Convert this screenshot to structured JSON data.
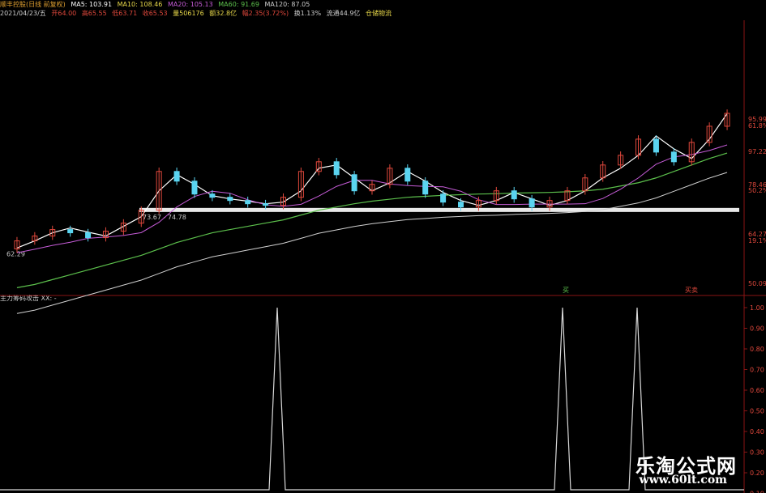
{
  "header": {
    "stock_title": "顺丰控股(日线 前复权)",
    "ma5": "MA5: 103.91",
    "ma10": "MA10: 108.46",
    "ma20": "MA20: 105.13",
    "ma60": "MA60: 91.69",
    "ma120": "MA120: 87.05",
    "date": "2021/04/23/五",
    "open": "开64.00",
    "high": "高65.55",
    "low": "低63.71",
    "close": "收65.53",
    "volume": "量506176",
    "amount": "额32.8亿",
    "change": "幅2.35(3.72%)",
    "turnover": "换1.13%",
    "float_cap": "流通44.9亿",
    "sector": "仓储物流"
  },
  "colors": {
    "bg": "#000000",
    "up": "#e0483c",
    "down": "#5ad4f0",
    "ma5": "#ffffff",
    "ma10": "#e8d84a",
    "ma20": "#c65cd8",
    "ma60": "#5cc04c",
    "ma120": "#d0d0d0",
    "axis": "#8a1515",
    "label_red": "#e0483c",
    "label_green": "#5cc04c",
    "label_magenta": "#c65cd8"
  },
  "main_chart": {
    "y_labels": [
      "95.99",
      "61.8%",
      "97.22",
      "78.46",
      "50.2%",
      "64.27",
      "19.1%",
      "50.09"
    ],
    "range_label": "73.67 - 74.78",
    "low_label": "62.29",
    "signal_marker_1": "买",
    "signal_marker_2": "买卖",
    "support_level_note": "horizontal band"
  },
  "sub_chart": {
    "title": "主力筹码攻击",
    "value_label": "XX: -",
    "y_labels": [
      "1.00",
      "0.90",
      "0.80",
      "0.70",
      "0.60",
      "0.50",
      "0.40",
      "0.30",
      "0.20",
      "0.10"
    ]
  },
  "chart_data": [
    {
      "type": "candlestick",
      "title": "顺丰控股(日线 前复权)",
      "series": [
        {
          "name": "MA5",
          "values": [
            62.3,
            64.5,
            67.0,
            68.5,
            67.2,
            66.0,
            69.0,
            72.0,
            80.0,
            85.0,
            82.0,
            78.5,
            77.5,
            76.8,
            76.0,
            76.5,
            80.0,
            87.0,
            88.0,
            84.0,
            80.0,
            82.5,
            86.0,
            83.0,
            79.5,
            77.0,
            75.5,
            77.0,
            79.5,
            77.5,
            75.5,
            77.0,
            80.0,
            84.0,
            87.0,
            91.0,
            97.0,
            93.0,
            90.0,
            96.0,
            103.9
          ]
        },
        {
          "name": "MA60",
          "values": [
            50.0,
            51.0,
            52.5,
            54.0,
            55.5,
            57.0,
            58.5,
            60.0,
            62.0,
            64.0,
            65.5,
            67.0,
            68.0,
            69.0,
            70.0,
            71.0,
            72.5,
            74.0,
            75.0,
            76.0,
            76.8,
            77.4,
            78.0,
            78.3,
            78.6,
            78.8,
            79.0,
            79.1,
            79.3,
            79.4,
            79.5,
            79.7,
            80.0,
            80.5,
            81.5,
            82.5,
            84.0,
            86.0,
            88.0,
            90.0,
            91.7
          ]
        }
      ],
      "candles": [
        {
          "o": 62.0,
          "c": 64.5
        },
        {
          "o": 64.5,
          "c": 66.0
        },
        {
          "o": 66.0,
          "c": 68.0
        },
        {
          "o": 68.0,
          "c": 67.0
        },
        {
          "o": 67.0,
          "c": 65.5
        },
        {
          "o": 65.5,
          "c": 67.5
        },
        {
          "o": 67.5,
          "c": 70.0
        },
        {
          "o": 70.0,
          "c": 74.0
        },
        {
          "o": 74.0,
          "c": 86.0
        },
        {
          "o": 86.0,
          "c": 83.0
        },
        {
          "o": 83.0,
          "c": 79.0
        },
        {
          "o": 79.0,
          "c": 78.0
        },
        {
          "o": 78.0,
          "c": 77.0
        },
        {
          "o": 77.0,
          "c": 76.0
        },
        {
          "o": 76.0,
          "c": 75.5
        },
        {
          "o": 75.5,
          "c": 78.0
        },
        {
          "o": 78.0,
          "c": 86.0
        },
        {
          "o": 86.0,
          "c": 89.0
        },
        {
          "o": 89.0,
          "c": 85.0
        },
        {
          "o": 85.0,
          "c": 80.0
        },
        {
          "o": 80.0,
          "c": 82.0
        },
        {
          "o": 82.0,
          "c": 87.0
        },
        {
          "o": 87.0,
          "c": 83.0
        },
        {
          "o": 83.0,
          "c": 79.0
        },
        {
          "o": 79.0,
          "c": 76.5
        },
        {
          "o": 76.5,
          "c": 75.0
        },
        {
          "o": 75.0,
          "c": 77.0
        },
        {
          "o": 77.0,
          "c": 80.0
        },
        {
          "o": 80.0,
          "c": 77.5
        },
        {
          "o": 77.5,
          "c": 75.0
        },
        {
          "o": 75.0,
          "c": 77.0
        },
        {
          "o": 77.0,
          "c": 80.0
        },
        {
          "o": 80.0,
          "c": 84.0
        },
        {
          "o": 84.0,
          "c": 88.0
        },
        {
          "o": 88.0,
          "c": 91.0
        },
        {
          "o": 91.0,
          "c": 96.0
        },
        {
          "o": 96.0,
          "c": 92.0
        },
        {
          "o": 92.0,
          "c": 89.0
        },
        {
          "o": 89.0,
          "c": 95.0
        },
        {
          "o": 95.0,
          "c": 100.0
        },
        {
          "o": 100.0,
          "c": 104.0
        }
      ],
      "support_level": 74.2,
      "ylim": [
        50.09,
        104.0
      ]
    },
    {
      "type": "line",
      "title": "主力筹码攻击",
      "series": [
        {
          "name": "XX",
          "spikes": [
            {
              "index": 14,
              "value": 1.0
            },
            {
              "index": 30,
              "value": 1.0
            },
            {
              "index": 34,
              "value": 1.0
            }
          ]
        }
      ],
      "ylim": [
        0.0,
        1.0
      ]
    }
  ]
}
